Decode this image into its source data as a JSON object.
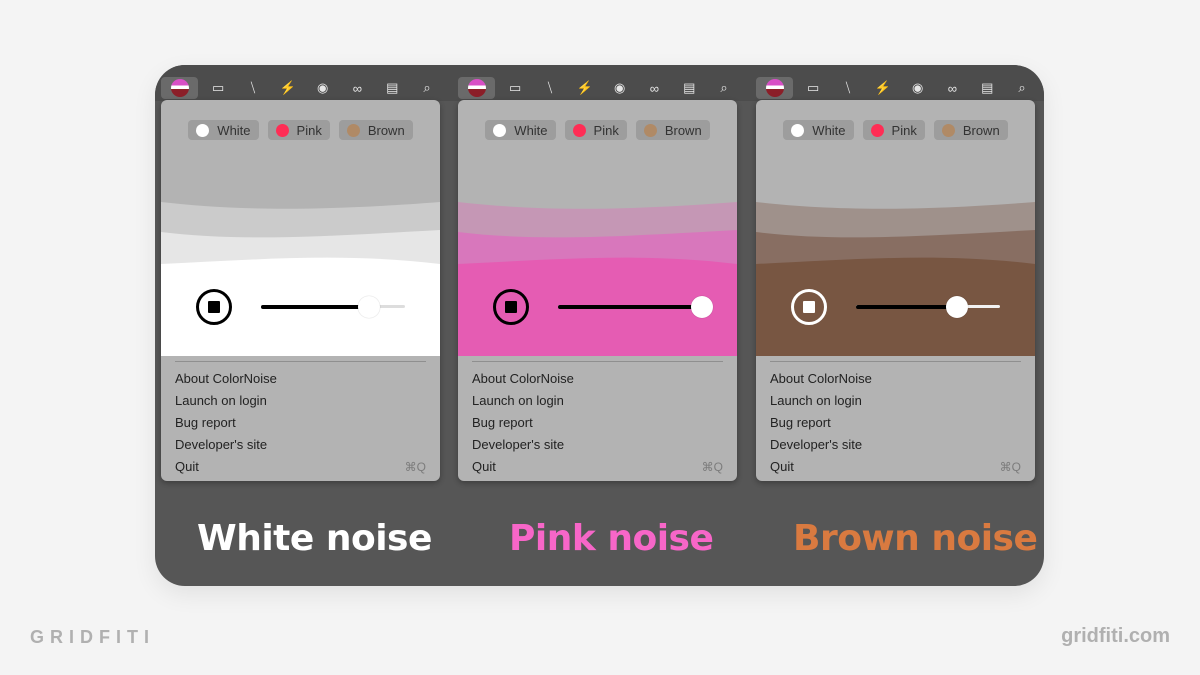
{
  "branding": {
    "left": "GRIDFITI",
    "right": "gridfiti.com"
  },
  "menubar_icons": [
    "colornoise-logo-icon",
    "display-icon",
    "mic-muted-icon",
    "battery-charging-icon",
    "user-circle-icon",
    "link-icon",
    "window-icon",
    "search-icon"
  ],
  "panels": [
    {
      "id": "white",
      "chips": [
        {
          "label": "White",
          "color": "#ffffff"
        },
        {
          "label": "Pink",
          "color": "#ff2d55"
        },
        {
          "label": "Brown",
          "color": "#b08a66"
        }
      ],
      "wave_colors": [
        "#b3b3b3",
        "#cbcbcb",
        "#e6e6e6",
        "#ffffff"
      ],
      "control_theme": "dark",
      "volume": 0.75,
      "caption": "White noise",
      "caption_color": "#ffffff"
    },
    {
      "id": "pink",
      "chips": [
        {
          "label": "White",
          "color": "#ffffff"
        },
        {
          "label": "Pink",
          "color": "#ff2d55"
        },
        {
          "label": "Brown",
          "color": "#b08a66"
        }
      ],
      "wave_colors": [
        "#b3b3b3",
        "#c597b5",
        "#d877bc",
        "#e55cb3"
      ],
      "control_theme": "dark",
      "volume": 1.0,
      "caption": "Pink noise",
      "caption_color": "#f766c8"
    },
    {
      "id": "brown",
      "chips": [
        {
          "label": "White",
          "color": "#ffffff"
        },
        {
          "label": "Pink",
          "color": "#ff2d55"
        },
        {
          "label": "Brown",
          "color": "#b08a66"
        }
      ],
      "wave_colors": [
        "#b3b3b3",
        "#9f918b",
        "#886e62",
        "#785642"
      ],
      "control_theme": "light",
      "volume": 0.7,
      "caption": "Brown noise",
      "caption_color": "#d97a40"
    }
  ],
  "menu": [
    {
      "label": "About ColorNoise",
      "shortcut": ""
    },
    {
      "label": "Launch on login",
      "shortcut": ""
    },
    {
      "label": "Bug report",
      "shortcut": ""
    },
    {
      "label": "Developer's site",
      "shortcut": ""
    },
    {
      "label": "Quit",
      "shortcut": "⌘Q"
    }
  ]
}
